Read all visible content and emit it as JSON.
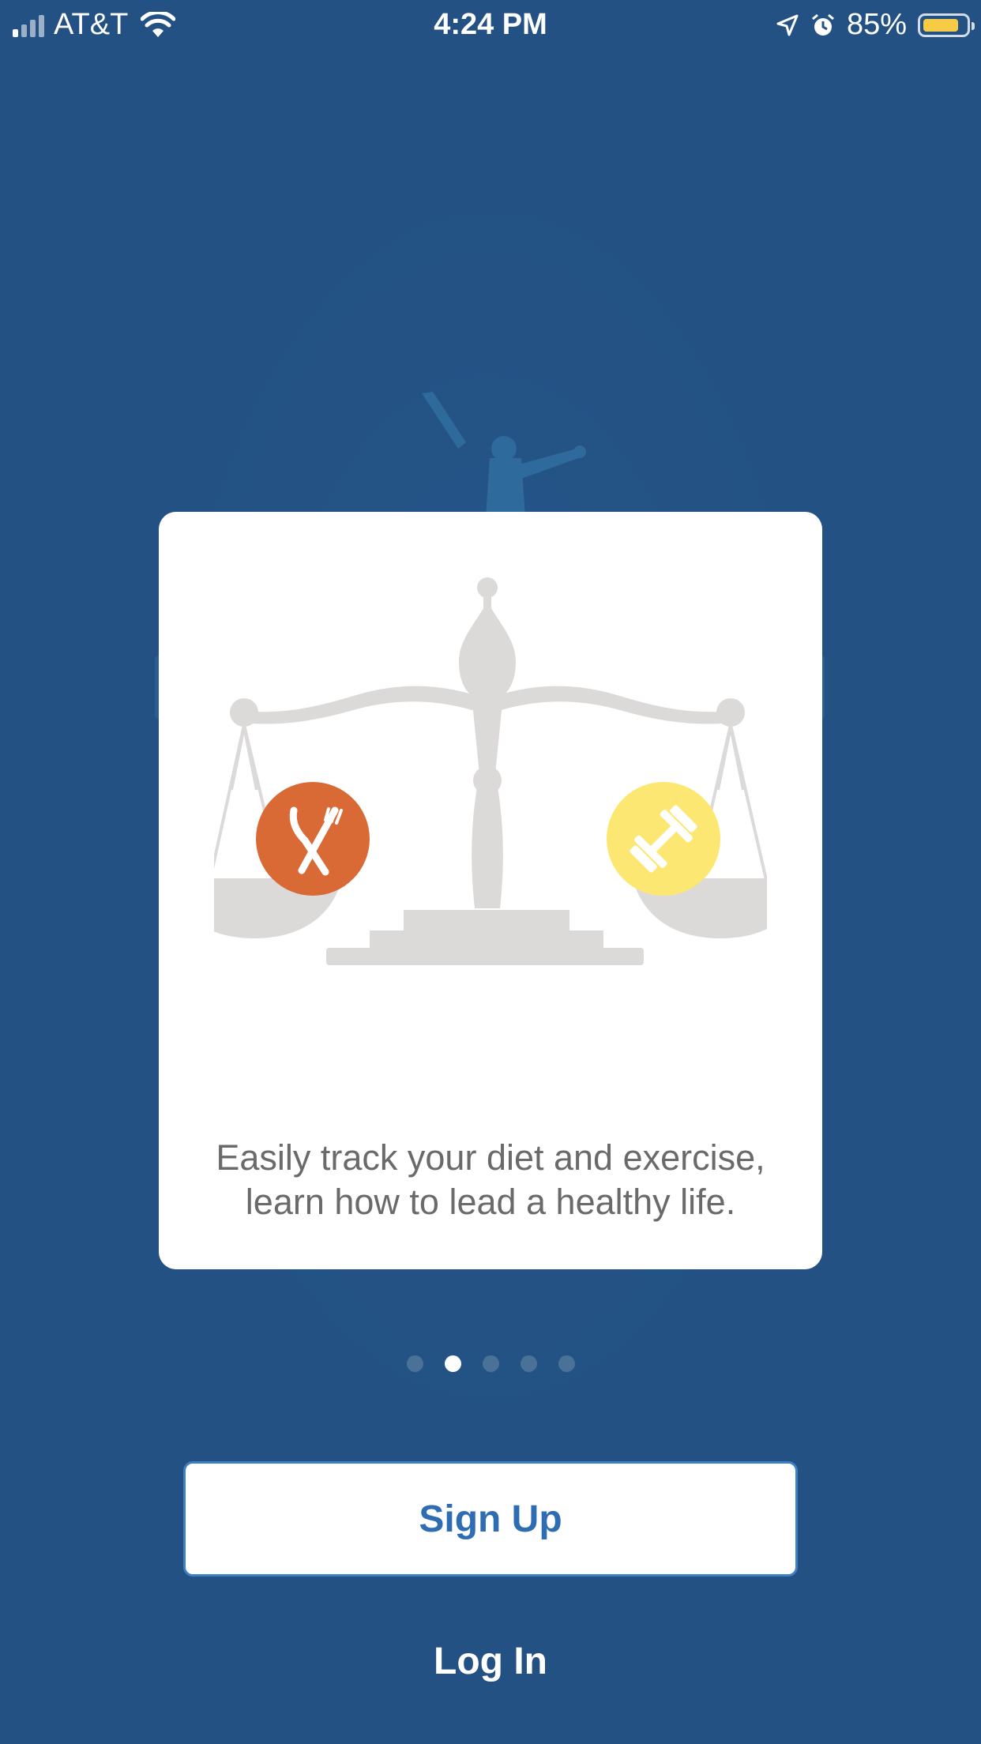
{
  "status_bar": {
    "carrier": "AT&T",
    "time": "4:24 PM",
    "battery_percent_label": "85%",
    "battery_level": 0.85,
    "battery_color": "#f7cb45",
    "icons": [
      "cellular-signal-icon",
      "wifi-icon",
      "location-arrow-icon",
      "alarm-icon",
      "battery-icon"
    ]
  },
  "onboarding": {
    "illustration_icons": [
      "balance-scale-icon",
      "fork-knife-icon",
      "dumbbell-icon"
    ],
    "colors": {
      "food_circle": "#d96a36",
      "exercise_circle": "#fbe772",
      "scale": "#dcd9d9"
    },
    "text_line1": "Easily track your diet and exercise,",
    "text_line2": "learn how to lead a healthy life.",
    "page_count": 5,
    "active_page": 2
  },
  "actions": {
    "signup_label": "Sign Up",
    "login_label": "Log In"
  },
  "theme": {
    "background": "#235183",
    "accent": "#2f6db3"
  }
}
